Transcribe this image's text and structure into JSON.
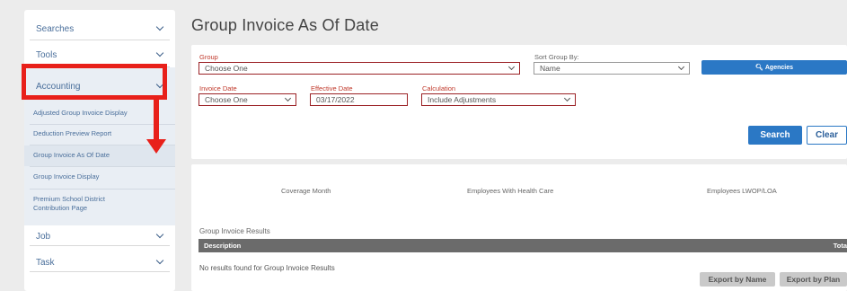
{
  "sidebar": {
    "items": [
      {
        "label": "Searches"
      },
      {
        "label": "Tools"
      },
      {
        "label": "Accounting"
      },
      {
        "label": "Job"
      },
      {
        "label": "Task"
      }
    ],
    "accounting_sub": [
      {
        "label": "Adjusted Group Invoice Display"
      },
      {
        "label": "Deduction Preview Report"
      },
      {
        "label": "Group Invoice As Of Date"
      },
      {
        "label": "Group Invoice Display"
      },
      {
        "label": "Premium School District",
        "label2": "Contribution Page"
      }
    ]
  },
  "page": {
    "title": "Group Invoice As Of Date"
  },
  "form": {
    "group_label": "Group",
    "group_value": "Choose One",
    "sort_label": "Sort Group By:",
    "sort_value": "Name",
    "agencies_button": "Agencies",
    "invoice_date_label": "Invoice Date",
    "invoice_date_value": "Choose One",
    "effective_date_label": "Effective Date",
    "effective_date_value": "03/17/2022",
    "calculation_label": "Calculation",
    "calculation_value": "Include Adjustments",
    "search_button": "Search",
    "clear_button": "Clear"
  },
  "summary": {
    "col1": "Coverage Month",
    "col2": "Employees With Health Care",
    "col3": "Employees LWOP/LOA"
  },
  "results": {
    "title": "Group Invoice Results",
    "columns": [
      "Description",
      "Tota"
    ],
    "empty_message": "No results found for Group Invoice Results",
    "export_name": "Export by Name",
    "export_plan": "Export by Plan"
  },
  "colors": {
    "accent": "#2b78c5",
    "highlight": "#e8201a",
    "required_border": "#9b2226"
  }
}
